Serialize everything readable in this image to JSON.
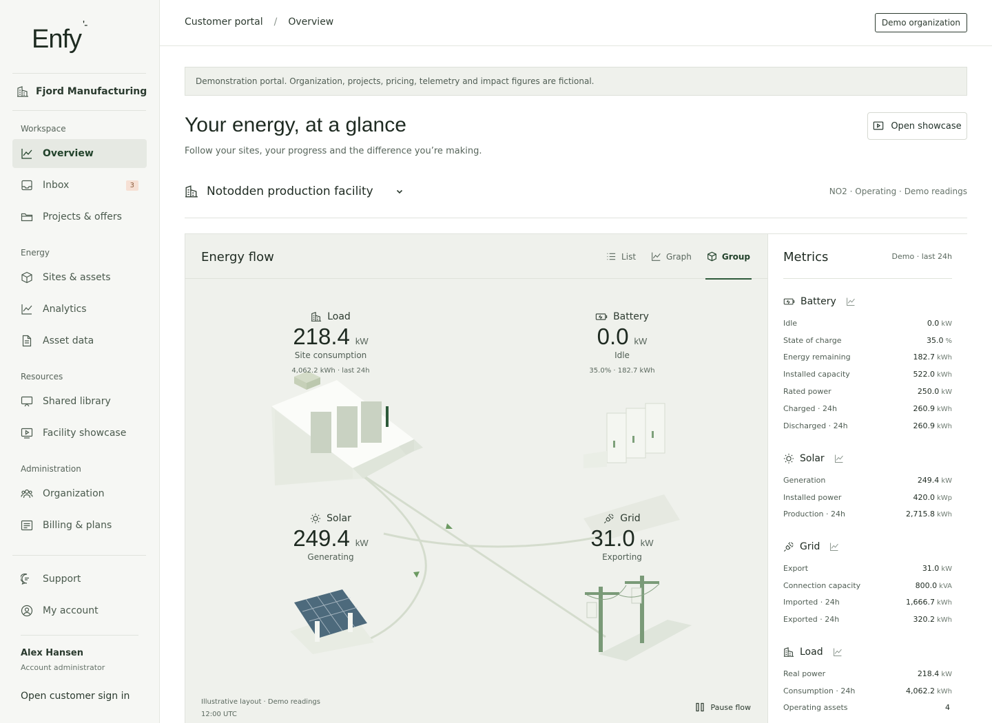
{
  "brand": {
    "logo": "Enfy",
    "logo_mark": "'-"
  },
  "org": {
    "name": "Fjord Manufacturing"
  },
  "sidebar": {
    "sections": [
      "Workspace",
      "Energy",
      "Resources",
      "Administration"
    ],
    "items": [
      {
        "label": "Overview",
        "icon": "chart-line-icon",
        "active": true
      },
      {
        "label": "Inbox",
        "icon": "inbox-icon",
        "badge": "3"
      },
      {
        "label": "Projects & offers",
        "icon": "folder-icon"
      },
      {
        "label": "Sites & assets",
        "icon": "cube-icon"
      },
      {
        "label": "Analytics",
        "icon": "chart-line-icon"
      },
      {
        "label": "Asset data",
        "icon": "document-icon"
      },
      {
        "label": "Shared library",
        "icon": "presentation-icon"
      },
      {
        "label": "Facility showcase",
        "icon": "play-screen-icon"
      },
      {
        "label": "Organization",
        "icon": "users-icon"
      },
      {
        "label": "Billing & plans",
        "icon": "receipt-icon"
      },
      {
        "label": "Support",
        "icon": "chat-icon"
      },
      {
        "label": "My account",
        "icon": "user-circle-icon"
      }
    ],
    "user": {
      "name": "Alex Hansen",
      "role": "Account administrator"
    },
    "signin": "Open customer sign in"
  },
  "topbar": {
    "breadcrumb": [
      "Customer portal",
      "Overview"
    ],
    "separator": "/",
    "demo_button": "Demo organization"
  },
  "notice": "Demonstration portal. Organization, projects, pricing, telemetry and impact figures are fictional.",
  "header": {
    "title": "Your energy, at a glance",
    "subtitle": "Follow your sites, your progress and the difference you’re making.",
    "showcase_button": "Open showcase"
  },
  "site": {
    "name": "Notodden production facility",
    "meta": "NO2 · Operating · Demo readings"
  },
  "flow": {
    "title": "Energy flow",
    "tabs": [
      "List",
      "Graph",
      "Group"
    ],
    "active_tab": "Group",
    "nodes": {
      "load": {
        "label": "Load",
        "value": "218.4",
        "unit": "kW",
        "status": "Site consumption",
        "extra": "4,062.2 kWh · last 24h"
      },
      "battery": {
        "label": "Battery",
        "value": "0.0",
        "unit": "kW",
        "status": "Idle",
        "extra": "35.0% · 182.7 kWh"
      },
      "solar": {
        "label": "Solar",
        "value": "249.4",
        "unit": "kW",
        "status": "Generating"
      },
      "grid": {
        "label": "Grid",
        "value": "31.0",
        "unit": "kW",
        "status": "Exporting"
      }
    },
    "footer": [
      "Illustrative layout · Demo readings",
      "12:00 UTC"
    ],
    "pause": "Pause flow"
  },
  "metrics": {
    "title": "Metrics",
    "subtitle": "Demo · last 24h",
    "groups": [
      {
        "name": "Battery",
        "rows": [
          [
            "Idle",
            "0.0",
            "kW"
          ],
          [
            "State of charge",
            "35.0",
            "%"
          ],
          [
            "Energy remaining",
            "182.7",
            "kWh"
          ],
          [
            "Installed capacity",
            "522.0",
            "kWh"
          ],
          [
            "Rated power",
            "250.0",
            "kW"
          ],
          [
            "Charged · 24h",
            "260.9",
            "kWh"
          ],
          [
            "Discharged · 24h",
            "260.9",
            "kWh"
          ]
        ]
      },
      {
        "name": "Solar",
        "rows": [
          [
            "Generation",
            "249.4",
            "kW"
          ],
          [
            "Installed power",
            "420.0",
            "kWp"
          ],
          [
            "Production · 24h",
            "2,715.8",
            "kWh"
          ]
        ]
      },
      {
        "name": "Grid",
        "rows": [
          [
            "Export",
            "31.0",
            "kW"
          ],
          [
            "Connection capacity",
            "800.0",
            "kVA"
          ],
          [
            "Imported · 24h",
            "1,666.7",
            "kWh"
          ],
          [
            "Exported · 24h",
            "320.2",
            "kWh"
          ]
        ]
      },
      {
        "name": "Load",
        "rows": [
          [
            "Real power",
            "218.4",
            "kW"
          ],
          [
            "Consumption · 24h",
            "4,062.2",
            "kWh"
          ],
          [
            "Operating assets",
            "4",
            ""
          ]
        ]
      }
    ]
  }
}
